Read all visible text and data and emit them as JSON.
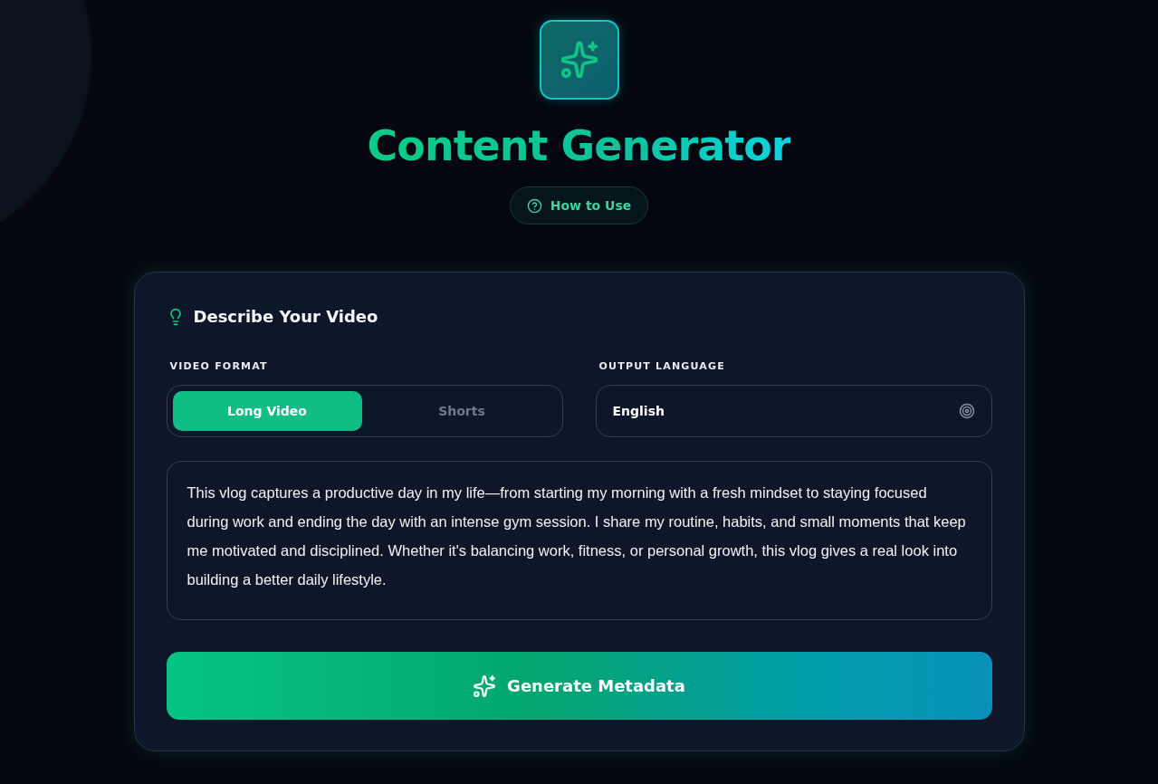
{
  "header": {
    "title": "Content Generator",
    "help_button": "How to Use"
  },
  "card": {
    "heading": "Describe Your Video",
    "video_format": {
      "label": "VIDEO FORMAT",
      "options": [
        {
          "label": "Long Video",
          "selected": true
        },
        {
          "label": "Shorts",
          "selected": false
        }
      ]
    },
    "output_language": {
      "label": "OUTPUT LANGUAGE",
      "value": "English"
    },
    "description": {
      "value": "This vlog captures a productive day in my life—from starting my morning with a fresh mindset to staying focused during work and ending the day with an intense gym session. I share my routine, habits, and small moments that keep me motivated and disciplined. Whether it's balancing work, fitness, or personal growth, this vlog gives a real look into building a better daily lifestyle."
    },
    "generate_button": "Generate Metadata"
  }
}
